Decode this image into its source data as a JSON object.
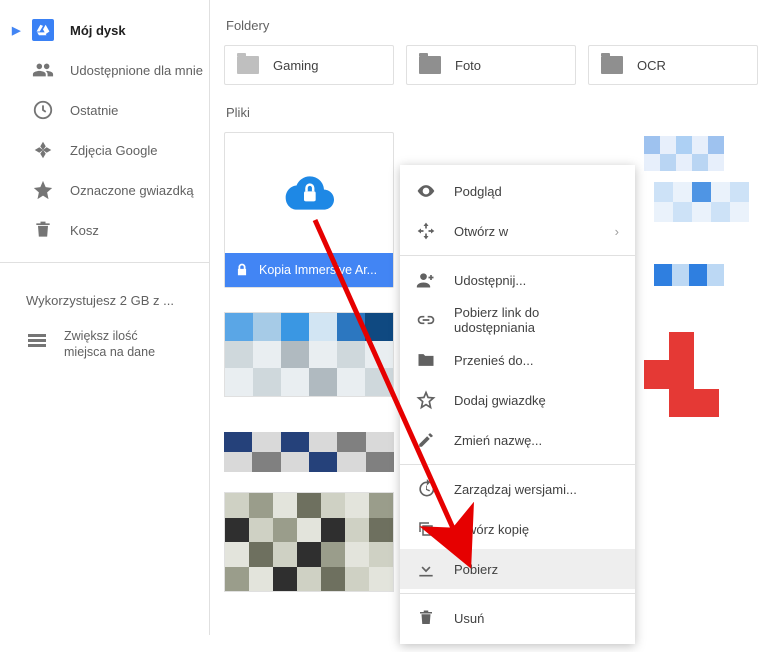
{
  "sidebar": {
    "items": [
      {
        "label": "Mój dysk"
      },
      {
        "label": "Udostępnione dla mnie"
      },
      {
        "label": "Ostatnie"
      },
      {
        "label": "Zdjęcia Google"
      },
      {
        "label": "Oznaczone gwiazdką"
      },
      {
        "label": "Kosz"
      }
    ],
    "storage_text": "Wykorzystujesz 2 GB z ...",
    "storage_link_line1": "Zwiększ ilość",
    "storage_link_line2": "miejsca na dane"
  },
  "main": {
    "folders_label": "Foldery",
    "files_label": "Pliki",
    "folders": [
      {
        "name": "Gaming"
      },
      {
        "name": "Foto"
      },
      {
        "name": "OCR"
      }
    ],
    "selected_file_name": "Kopia Immersive Ar..."
  },
  "context_menu": {
    "preview": "Podgląd",
    "open_with": "Otwórz w",
    "share": "Udostępnij...",
    "get_link": "Pobierz link do udostępniania",
    "move_to": "Przenieś do...",
    "add_star": "Dodaj gwiazdkę",
    "rename": "Zmień nazwę...",
    "manage_versions": "Zarządzaj wersjami...",
    "make_copy": "Utwórz kopię",
    "download": "Pobierz",
    "remove": "Usuń"
  }
}
